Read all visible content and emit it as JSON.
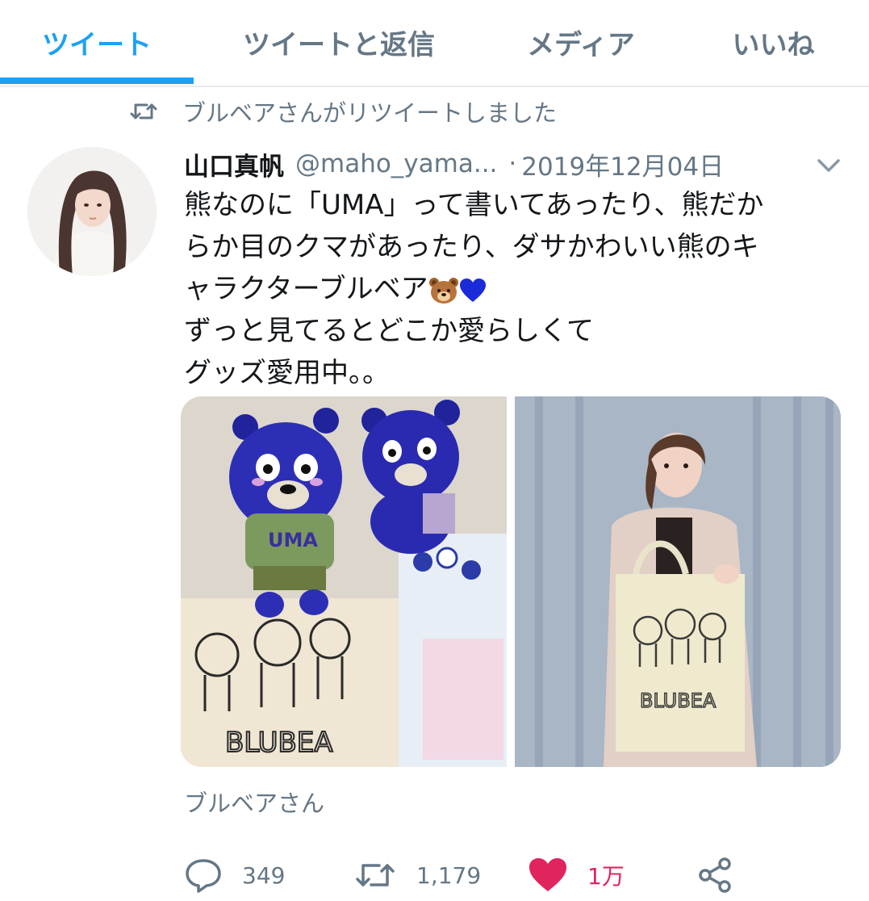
{
  "tabs": [
    {
      "label": "ツイート",
      "active": true
    },
    {
      "label": "ツイートと返信",
      "active": false
    },
    {
      "label": "メディア",
      "active": false
    },
    {
      "label": "いいね",
      "active": false
    }
  ],
  "retweet_context": {
    "icon": "retweet-icon",
    "text": "ブルベアさんがリツイートしました"
  },
  "tweet": {
    "author_name": "山口真帆",
    "handle": "@maho_yama...",
    "separator": "·",
    "date": "2019年12月04日",
    "text_lines": [
      "熊なのに「UMA」って書いてあったり、熊だか",
      "らか目のクマがあったり、ダサかわいい熊のキ",
      "ャラクターブルベア",
      "ずっと見てるとどこか愛らしくて",
      "グッズ愛用中。。"
    ],
    "emojis": [
      "bear-face-emoji",
      "blue-heart-emoji"
    ],
    "media_tote_text": "BLUBEA",
    "media_shirt_text": "UMA",
    "source_label": "ブルベアさん"
  },
  "actions": {
    "reply_count": "349",
    "retweet_count": "1,179",
    "like_count": "1万",
    "liked": true
  },
  "colors": {
    "accent": "#1da1f2",
    "secondary_text": "#657786",
    "like": "#e0245e",
    "divider": "#e6ecf0"
  }
}
